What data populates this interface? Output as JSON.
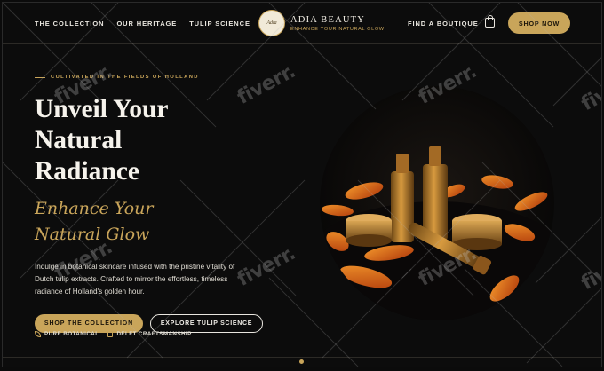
{
  "nav": {
    "links": [
      "THE COLLECTION",
      "OUR HERITAGE",
      "TULIP SCIENCE"
    ],
    "right_link": "FIND A BOUTIQUE",
    "cta": "SHOP NOW"
  },
  "brand": {
    "name": "ADIA BEAUTY",
    "tagline": "ENHANCE YOUR NATURAL GLOW",
    "logo_text": "Adia"
  },
  "hero": {
    "eyebrow": "CULTIVATED IN THE FIELDS OF HOLLAND",
    "headline": [
      "Unveil Your",
      "Natural",
      "Radiance"
    ],
    "script": "Enhance Your Natural Glow",
    "body": "Indulge in botanical skincare infused with the pristine vitality of Dutch tulip extracts. Crafted to mirror the effortless, timeless radiance of Holland's golden hour.",
    "primary_cta": "SHOP THE COLLECTION",
    "secondary_cta": "EXPLORE TULIP SCIENCE",
    "features": [
      "PURE BOTANICAL",
      "DELFT CRAFTSMANSHIP"
    ]
  },
  "watermark": "fiverr.",
  "colors": {
    "background": "#0c0c0c",
    "gold": "#c9a55a",
    "text": "#f2efe8"
  }
}
